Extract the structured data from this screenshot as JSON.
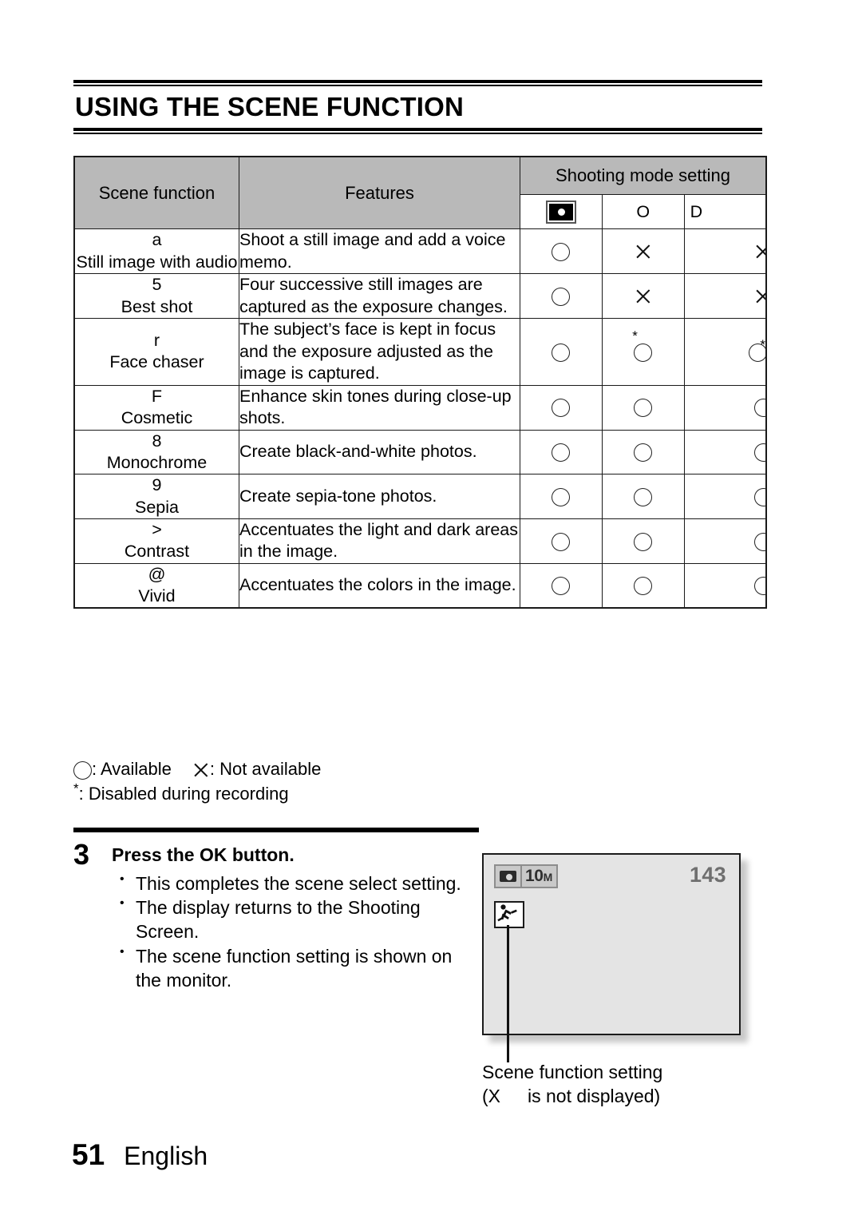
{
  "heading": {
    "title": "USING THE SCENE FUNCTION"
  },
  "table": {
    "columns": {
      "scene_function": "Scene function",
      "features": "Features",
      "shooting_mode_setting": "Shooting mode setting",
      "mode_icons": [
        "camera-icon",
        "O",
        "D"
      ]
    },
    "rows": [
      {
        "symbol": "a",
        "name": "Still image with audio",
        "feature": "Shoot a still image and add a voice memo.",
        "marks": [
          "circle",
          "cross",
          "cross"
        ]
      },
      {
        "symbol": "5",
        "name": "Best shot",
        "feature": "Four successive still images are captured as the exposure changes.",
        "marks": [
          "circle",
          "cross",
          "cross"
        ]
      },
      {
        "symbol": "r",
        "name": "Face chaser",
        "feature": "The subject’s face is kept in focus and the exposure adjusted as the image is captured.",
        "marks": [
          "circle",
          "circle-star",
          "circle-star"
        ]
      },
      {
        "symbol": "F",
        "name": "Cosmetic",
        "feature": "Enhance skin tones during close-up shots.",
        "marks": [
          "circle",
          "circle",
          "circle"
        ]
      },
      {
        "symbol": "8",
        "name": "Monochrome",
        "feature": "Create black-and-white photos.",
        "marks": [
          "circle",
          "circle",
          "circle"
        ]
      },
      {
        "symbol": "9",
        "name": "Sepia",
        "feature": "Create sepia-tone photos.",
        "marks": [
          "circle",
          "circle",
          "circle"
        ]
      },
      {
        "symbol": ">",
        "name": "Contrast",
        "feature": "Accentuates the light and dark areas in the image.",
        "marks": [
          "circle",
          "circle",
          "circle"
        ]
      },
      {
        "symbol": "@",
        "name": "Vivid",
        "feature": "Accentuates the colors in the image.",
        "marks": [
          "circle",
          "circle",
          "circle"
        ]
      }
    ]
  },
  "legend": {
    "available": ": Available",
    "not_available": ": Not available",
    "disabled": ":  Disabled during recording"
  },
  "step": {
    "number": "3",
    "title": "Press the OK button.",
    "bullets": [
      "This completes the scene select setting.",
      "The display returns to the Shooting Screen.",
      "The scene function setting is shown on the monitor."
    ]
  },
  "monitor": {
    "resolution": "10",
    "resolution_unit": "M",
    "shot_count": "143",
    "scene_icon": "running-person-icon"
  },
  "caption": {
    "line1": "Scene function setting",
    "line2_open": "(X",
    "line2_rest": "is not displayed)"
  },
  "footer": {
    "page_number": "51",
    "language": "English"
  }
}
